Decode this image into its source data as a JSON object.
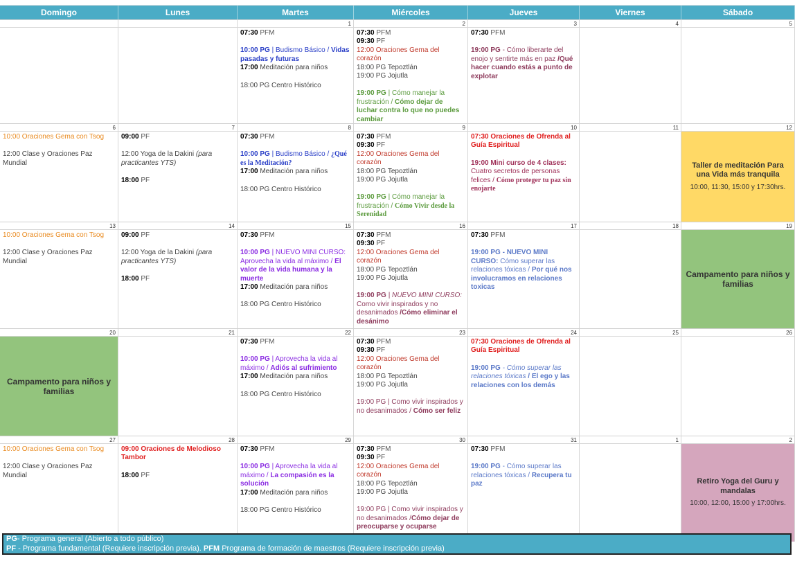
{
  "days": [
    "Domingo",
    "Lunes",
    "Martes",
    "Miércoles",
    "Jueves",
    "Viernes",
    "Sábado"
  ],
  "weeks": [
    {
      "nums": [
        "",
        "",
        "1",
        "2",
        "3",
        "4",
        "5"
      ],
      "cells": [
        [],
        [],
        [
          [
            [
              "t",
              "07:30"
            ],
            [
              "lbl",
              " PFM"
            ]
          ],
          [
            [
              "gap",
              ""
            ]
          ],
          [
            [
              "blueb",
              "10:00 PG"
            ],
            [
              "blue",
              " | Budismo Básico / "
            ],
            [
              "blueb",
              "Vidas pasadas y futuras"
            ]
          ],
          [
            [
              "t",
              "17:00"
            ],
            [
              "gray",
              " Meditación para niños"
            ]
          ],
          [
            [
              "gap",
              ""
            ]
          ],
          [
            [
              "gray",
              "18:00 PG Centro Histórico"
            ]
          ]
        ],
        [
          [
            [
              "t",
              "07:30"
            ],
            [
              "lbl",
              " PFM"
            ]
          ],
          [
            [
              "t",
              "09:30"
            ],
            [
              "lbl",
              " PF"
            ]
          ],
          [
            [
              "red",
              "12:00 Oraciones Gema del corazón"
            ]
          ],
          [
            [
              "gray",
              "18:00 PG Tepoztlán"
            ]
          ],
          [
            [
              "gray",
              "19:00 PG Jojutla"
            ]
          ],
          [
            [
              "gap",
              ""
            ]
          ],
          [
            [
              "greenb",
              "19:00 PG"
            ],
            [
              "green",
              " | Cómo manejar la frustración / "
            ],
            [
              "greenb",
              " Cómo dejar de luchar contra lo que no puedes cambiar"
            ]
          ]
        ],
        [
          [
            [
              "t",
              "07:30"
            ],
            [
              "lbl",
              " PFM"
            ]
          ],
          [
            [
              "gap",
              ""
            ]
          ],
          [
            [
              "maroonb",
              "19:00 PG"
            ],
            [
              "maroon",
              " - Cómo liberarte del enojo y sentirte más en paz "
            ],
            [
              "maroonb",
              "/Qué hacer cuando estás a punto de explotar"
            ]
          ]
        ],
        [],
        []
      ]
    },
    {
      "nums": [
        "6",
        "7",
        "8",
        "9",
        "10",
        "11",
        "12"
      ],
      "cells": [
        [
          [
            [
              "orange",
              "10:00 Oraciones Gema con Tsog"
            ]
          ],
          [
            [
              "gap",
              ""
            ]
          ],
          [
            [
              "gray",
              "12:00 Clase y Oraciones Paz Mundial"
            ]
          ]
        ],
        [
          [
            [
              "t",
              "09:00"
            ],
            [
              "lbl",
              " PF"
            ]
          ],
          [
            [
              "gap",
              ""
            ]
          ],
          [
            [
              "gray",
              "12:00 Yoga de la Dakini "
            ],
            [
              "gray it",
              " (para practicantes YTS)"
            ]
          ],
          [
            [
              "gap",
              ""
            ]
          ],
          [
            [
              "t",
              "18:00"
            ],
            [
              "lbl",
              " PF"
            ]
          ]
        ],
        [
          [
            [
              "t",
              "07:30"
            ],
            [
              "lbl",
              " PFM"
            ]
          ],
          [
            [
              "gap",
              ""
            ]
          ],
          [
            [
              "blueb",
              "10:00 PG"
            ],
            [
              "blue",
              " | Budismo Básico / "
            ],
            [
              "blueb serifb",
              "¿Qué es la Meditación?"
            ]
          ],
          [
            [
              "t",
              "17:00"
            ],
            [
              "gray",
              " Meditación para niños"
            ]
          ],
          [
            [
              "gap",
              ""
            ]
          ],
          [
            [
              "gray",
              "18:00 PG Centro Histórico"
            ]
          ]
        ],
        [
          [
            [
              "t",
              "07:30"
            ],
            [
              "lbl",
              " PFM"
            ]
          ],
          [
            [
              "t",
              "09:30"
            ],
            [
              "lbl",
              " PF"
            ]
          ],
          [
            [
              "red",
              "12:00 Oraciones Gema del corazón"
            ]
          ],
          [
            [
              "gray",
              "18:00 PG Tepoztlán"
            ]
          ],
          [
            [
              "gray",
              "19:00 PG Jojutla"
            ]
          ],
          [
            [
              "gap",
              ""
            ]
          ],
          [
            [
              "greenb",
              "19:00 PG"
            ],
            [
              "green",
              " | Cómo manejar la frustración / "
            ],
            [
              "greenb serifb",
              " Cómo Vivir desde la Serenidad"
            ]
          ]
        ],
        [
          [
            [
              "redb",
              "07:30 Oraciones de Ofrenda al Guía Espiritual"
            ]
          ],
          [
            [
              "gap",
              ""
            ]
          ],
          [
            [
              "wineb",
              "19:00 Mini curso de 4 clases:"
            ],
            [
              "wine",
              " Cuatro secretos de personas felices / "
            ],
            [
              "wineb serifb",
              "Cómo proteger tu paz sin enojarte"
            ]
          ]
        ],
        [],
        "EV1"
      ]
    },
    {
      "nums": [
        "13",
        "14",
        "15",
        "16",
        "17",
        "18",
        "19"
      ],
      "cells": [
        [
          [
            [
              "orange",
              "10:00 Oraciones Gema con Tsog"
            ]
          ],
          [
            [
              "gap",
              ""
            ]
          ],
          [
            [
              "gray",
              "12:00 Clase y Oraciones Paz Mundial"
            ]
          ]
        ],
        [
          [
            [
              "t",
              "09:00"
            ],
            [
              "lbl",
              " PF"
            ]
          ],
          [
            [
              "gap",
              ""
            ]
          ],
          [
            [
              "gray",
              "12:00 Yoga de la Dakini "
            ],
            [
              "gray it",
              " (para practicantes YTS)"
            ]
          ],
          [
            [
              "gap",
              ""
            ]
          ],
          [
            [
              "t",
              "18:00"
            ],
            [
              "lbl",
              " PF"
            ]
          ]
        ],
        [
          [
            [
              "t",
              "07:30"
            ],
            [
              "lbl",
              " PFM"
            ]
          ],
          [
            [
              "gap",
              ""
            ]
          ],
          [
            [
              "purpleb",
              "10:00 PG"
            ],
            [
              "purple",
              " | NUEVO MINI CURSO: Aprovecha la vida al máximo / "
            ],
            [
              "purpleb",
              "El valor de la vida humana y la muerte"
            ]
          ],
          [
            [
              "t",
              "17:00"
            ],
            [
              "gray",
              " Meditación para niños"
            ]
          ],
          [
            [
              "gap",
              ""
            ]
          ],
          [
            [
              "gray",
              "18:00 PG Centro Histórico"
            ]
          ]
        ],
        [
          [
            [
              "t",
              "07:30"
            ],
            [
              "lbl",
              " PFM"
            ]
          ],
          [
            [
              "t",
              "09:30"
            ],
            [
              "lbl",
              " PF"
            ]
          ],
          [
            [
              "red",
              "12:00 Oraciones Gema del corazón"
            ]
          ],
          [
            [
              "gray",
              "18:00 PG Tepoztlán"
            ]
          ],
          [
            [
              "gray",
              "19:00 PG Jojutla"
            ]
          ],
          [
            [
              "gap",
              ""
            ]
          ],
          [
            [
              "maroonb",
              "19:00 PG"
            ],
            [
              "maroon it",
              " | NUEVO MINI CURSO: "
            ],
            [
              "maroon",
              "Como vivir inspirados y no desanimados "
            ],
            [
              "maroonb",
              "/Cómo eliminar el desánimo"
            ]
          ]
        ],
        [
          [
            [
              "t",
              "07:30"
            ],
            [
              "lbl",
              " PFM"
            ]
          ],
          [
            [
              "gap",
              ""
            ]
          ],
          [
            [
              "steelb",
              "19:00 PG - NUEVO MINI CURSO:"
            ],
            [
              "steel",
              " Cómo superar las relaciones tóxicas / "
            ],
            [
              "steelb",
              "Por qué nos involucramos en relaciones toxicas"
            ]
          ]
        ],
        [],
        "EV2"
      ]
    },
    {
      "nums": [
        "20",
        "21",
        "22",
        "23",
        "24",
        "25",
        "26"
      ],
      "cells": [
        "EV3",
        [],
        [
          [
            [
              "t",
              "07:30"
            ],
            [
              "lbl",
              " PFM"
            ]
          ],
          [
            [
              "gap",
              ""
            ]
          ],
          [
            [
              "purpleb",
              "10:00 PG"
            ],
            [
              "purple",
              " | Aprovecha la vida al máximo / "
            ],
            [
              "purpleb",
              "Adiós al sufrimiento"
            ]
          ],
          [
            [
              "t",
              "17:00"
            ],
            [
              "gray",
              " Meditación para niños"
            ]
          ],
          [
            [
              "gap",
              ""
            ]
          ],
          [
            [
              "gray",
              "18:00 PG Centro Histórico"
            ]
          ]
        ],
        [
          [
            [
              "t",
              "07:30"
            ],
            [
              "lbl",
              " PFM"
            ]
          ],
          [
            [
              "t",
              "09:30"
            ],
            [
              "lbl",
              " PF"
            ]
          ],
          [
            [
              "red",
              "12:00 Oraciones Gema del corazón"
            ]
          ],
          [
            [
              "gray",
              "18:00 PG Tepoztlán"
            ]
          ],
          [
            [
              "gray",
              "19:00 PG Jojutla"
            ]
          ],
          [
            [
              "gap",
              ""
            ]
          ],
          [
            [
              "maroon",
              "19:00 PG | Como vivir inspirados y no desanimados / "
            ],
            [
              "maroonb",
              "Cómo ser feliz"
            ]
          ]
        ],
        [
          [
            [
              "redb",
              "07:30 Oraciones de Ofrenda al Guía Espiritual"
            ]
          ],
          [
            [
              "gap",
              ""
            ]
          ],
          [
            [
              "steelb",
              "19:00 PG"
            ],
            [
              "steel it",
              " - Cómo superar las relaciones tóxicas "
            ],
            [
              "steelb",
              "/ El ego y las relaciones con los demás"
            ]
          ]
        ],
        [],
        []
      ]
    },
    {
      "nums": [
        "27",
        "28",
        "29",
        "30",
        "31",
        "1",
        "2"
      ],
      "cells": [
        [
          [
            [
              "orange",
              "10:00 Oraciones Gema con Tsog"
            ]
          ],
          [
            [
              "gap",
              ""
            ]
          ],
          [
            [
              "gray",
              "12:00 Clase y Oraciones Paz Mundial"
            ]
          ]
        ],
        [
          [
            [
              "redb",
              "09:00 Oraciones de Melodioso Tambor"
            ]
          ],
          [
            [
              "gap",
              ""
            ]
          ],
          [
            [
              "t",
              "18:00"
            ],
            [
              "lbl",
              " PF"
            ]
          ]
        ],
        [
          [
            [
              "t",
              "07:30"
            ],
            [
              "lbl",
              " PFM"
            ]
          ],
          [
            [
              "gap",
              ""
            ]
          ],
          [
            [
              "purpleb",
              "10:00 PG"
            ],
            [
              "purple",
              " | Aprovecha la vida al máximo / "
            ],
            [
              "purpleb",
              "La compasión es la solución"
            ]
          ],
          [
            [
              "t",
              "17:00"
            ],
            [
              "gray",
              " Meditación para niños"
            ]
          ],
          [
            [
              "gap",
              ""
            ]
          ],
          [
            [
              "gray",
              "18:00 PG Centro Histórico"
            ]
          ]
        ],
        [
          [
            [
              "t",
              "07:30"
            ],
            [
              "lbl",
              " PFM"
            ]
          ],
          [
            [
              "t",
              "09:30"
            ],
            [
              "lbl",
              " PF"
            ]
          ],
          [
            [
              "red",
              "12:00 Oraciones Gema del corazón"
            ]
          ],
          [
            [
              "gray",
              "18:00 PG Tepoztlán"
            ]
          ],
          [
            [
              "gray",
              "19:00 PG Jojutla"
            ]
          ],
          [
            [
              "gap",
              ""
            ]
          ],
          [
            [
              "maroon",
              "19:00 PG | Como vivir inspirados y no desanimados /"
            ],
            [
              "maroonb",
              "Cómo dejar de preocuparse y ocuparse"
            ]
          ]
        ],
        [
          [
            [
              "t",
              "07:30"
            ],
            [
              "lbl",
              " PFM"
            ]
          ],
          [
            [
              "gap",
              ""
            ]
          ],
          [
            [
              "steelb",
              "19:00 PG"
            ],
            [
              "steel",
              " - Cómo superar las relaciones tóxicas / "
            ],
            [
              "steelb",
              "Recupera tu paz"
            ]
          ]
        ],
        [],
        "EV4"
      ]
    }
  ],
  "events": {
    "EV1": {
      "style": "event-yellow",
      "title": "Taller de meditación Para una Vida más tranquila",
      "sub": "10:00, 11:30, 15:00 y 17:30hrs."
    },
    "EV2": {
      "style": "event-green",
      "title": "Campamento para niños y familias",
      "sub": ""
    },
    "EV3": {
      "style": "event-green",
      "title": "Campamento para niños y familias",
      "sub": ""
    },
    "EV4": {
      "style": "event-pink",
      "title": "Retiro Yoga del Guru y mandalas",
      "sub": "10:00, 12:00, 15:00 y 17:00hrs."
    }
  },
  "legend": {
    "pg_key": "PG",
    "pg_text": "- Programa general (Abierto a todo público)",
    "pf_key": "PF",
    "pf_text": " - Programa fundamental (Requiere inscripción previa).  ",
    "pfm_key": "PFM",
    "pfm_text": " Programa de formación de maestros (Requiere inscripción previa)"
  },
  "colors": {
    "header": "#4bacc6",
    "yellow_event": "#ffd966",
    "green_event": "#93c47d",
    "pink_event": "#d5a6bd"
  }
}
